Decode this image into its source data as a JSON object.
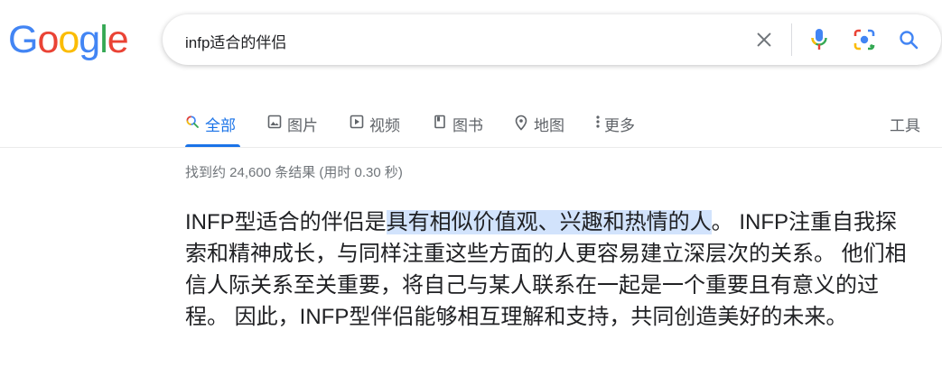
{
  "logo": {
    "text": "Google",
    "letters": [
      "G",
      "o",
      "o",
      "g",
      "l",
      "e"
    ],
    "colors": [
      "#4285f4",
      "#ea4335",
      "#fbbc05",
      "#4285f4",
      "#34a853",
      "#ea4335"
    ]
  },
  "search": {
    "query": "infp适合的伴侣"
  },
  "search_icons": [
    "clear-icon",
    "mic-icon",
    "lens-icon",
    "search-icon"
  ],
  "tabs": [
    {
      "label": "全部",
      "icon": "search-icon",
      "active": true
    },
    {
      "label": "图片",
      "icon": "image-icon"
    },
    {
      "label": "视频",
      "icon": "play-icon"
    },
    {
      "label": "图书",
      "icon": "book-icon"
    },
    {
      "label": "地图",
      "icon": "map-pin-icon"
    },
    {
      "label": "更多",
      "icon": "more-vert-icon"
    }
  ],
  "tools_label": "工具",
  "stats": "找到约 24,600 条结果  (用时 0.30 秒)",
  "snippet": {
    "before": "INFP型适合的伴侣是",
    "highlight": "具有相似价值观、兴趣和热情的人",
    "after": "。 INFP注重自我探索和精神成长，与同样注重这些方面的人更容易建立深层次的关系。 他们相信人际关系至关重要，将自己与某人联系在一起是一个重要且有意义的过程。 因此，INFP型伴侣能够相互理解和支持，共同创造美好的未来。"
  },
  "colors": {
    "accent": "#1a73e8",
    "text": "#202124",
    "muted": "#70757a",
    "highlight": "#d2e3fc"
  }
}
